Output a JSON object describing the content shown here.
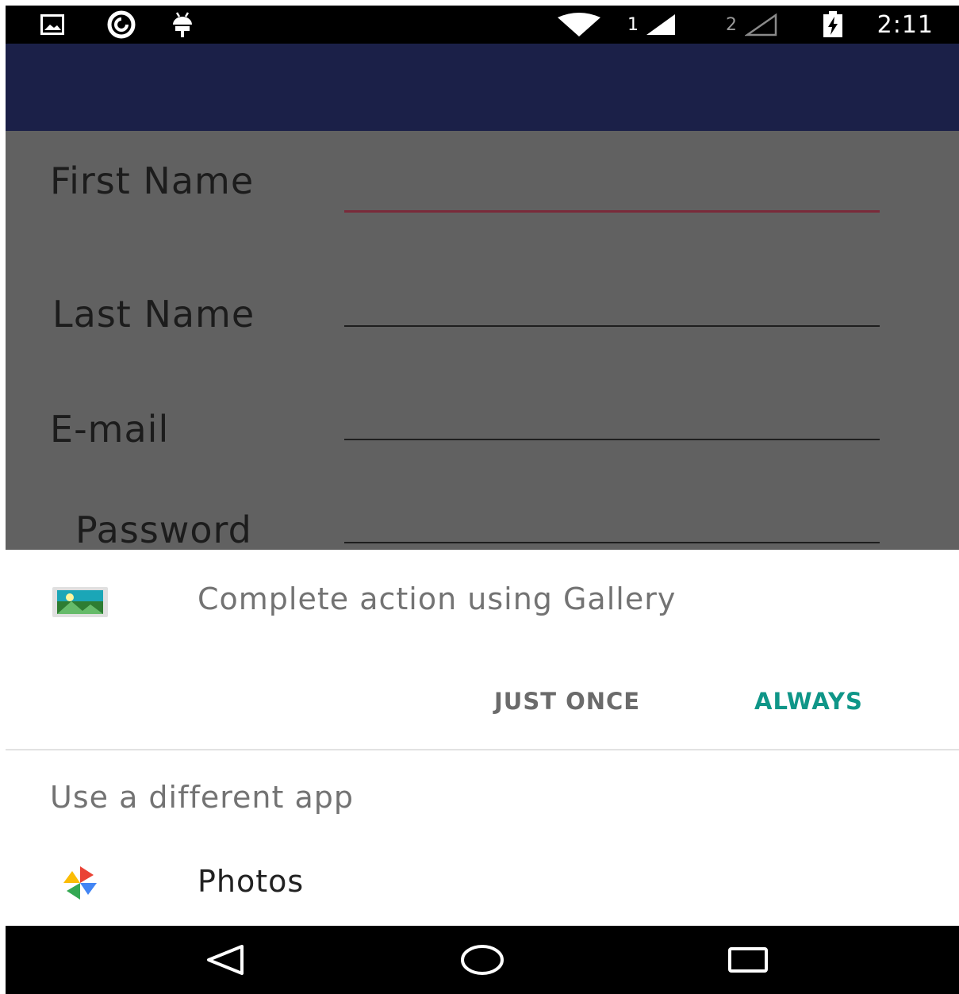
{
  "status_bar": {
    "icons": [
      "image-notification-icon",
      "spiral-app-icon",
      "android-debug-icon",
      "wifi-icon",
      "signal-sim1-icon",
      "signal-sim2-icon",
      "battery-charging-icon"
    ],
    "sim1_label": "1",
    "sim2_label": "2",
    "time": "2:11"
  },
  "app_bar": {
    "color": "#1b2048"
  },
  "form": {
    "first_name_label": "First Name",
    "last_name_label": "Last Name",
    "email_label": "E-mail",
    "password_label": "Password"
  },
  "chooser": {
    "title": "Complete action using Gallery",
    "just_once_label": "JUST ONCE",
    "always_label": "ALWAYS",
    "other_apps_title": "Use a different app",
    "apps": [
      {
        "label": "Photos",
        "icon": "google-photos-icon"
      }
    ]
  },
  "nav_bar": {
    "icons": [
      "back-icon",
      "home-icon",
      "recents-icon"
    ]
  },
  "colors": {
    "accent": "#0f9688",
    "scrim": "#616161",
    "primary_dark": "#1b2048"
  }
}
